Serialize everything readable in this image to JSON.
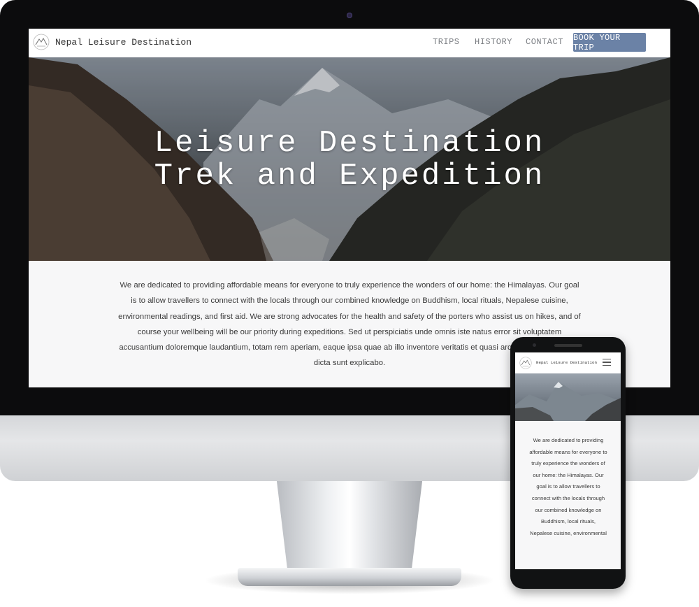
{
  "site": {
    "brand_name": "Nepal Leisure Destination",
    "logo_icon": "mountain-logo-icon"
  },
  "nav": {
    "items": [
      {
        "label": "TRIPS"
      },
      {
        "label": "HISTORY"
      },
      {
        "label": "CONTACT"
      }
    ],
    "cta_label": "BOOK YOUR TRIP"
  },
  "hero": {
    "title_line1": "Leisure Destination",
    "title_line2": "Trek and Expedition"
  },
  "intro": {
    "text": "We are dedicated to providing affordable means for everyone to truly experience the wonders of our home: the Himalayas. Our goal is to allow travellers to connect with the locals through our combined knowledge on Buddhism, local rituals, Nepalese cuisine, environmental readings, and first aid. We are strong advocates for the health and safety of the porters who assist us on hikes, and of course your wellbeing will be our priority during expeditions. Sed ut perspiciatis unde omnis iste natus error sit voluptatem accusantium doloremque laudantium, totam rem aperiam, eaque ipsa quae ab illo inventore veritatis et quasi architecto beatae vitae dicta sunt explicabo."
  },
  "mobile": {
    "brand_name": "Nepal Leisure Destination",
    "menu_icon": "hamburger-menu-icon",
    "intro_text": "We are dedicated to providing affordable means for everyone to truly experience the wonders of our home: the Himalayas. Our goal is to allow travellers to connect with the locals through our combined knowledge on Buddhism, local rituals, Nepalese cuisine, environmental"
  },
  "colors": {
    "cta_background": "#6b82a6",
    "nav_link": "#7a7d82",
    "body_text": "#3a3a3a"
  }
}
